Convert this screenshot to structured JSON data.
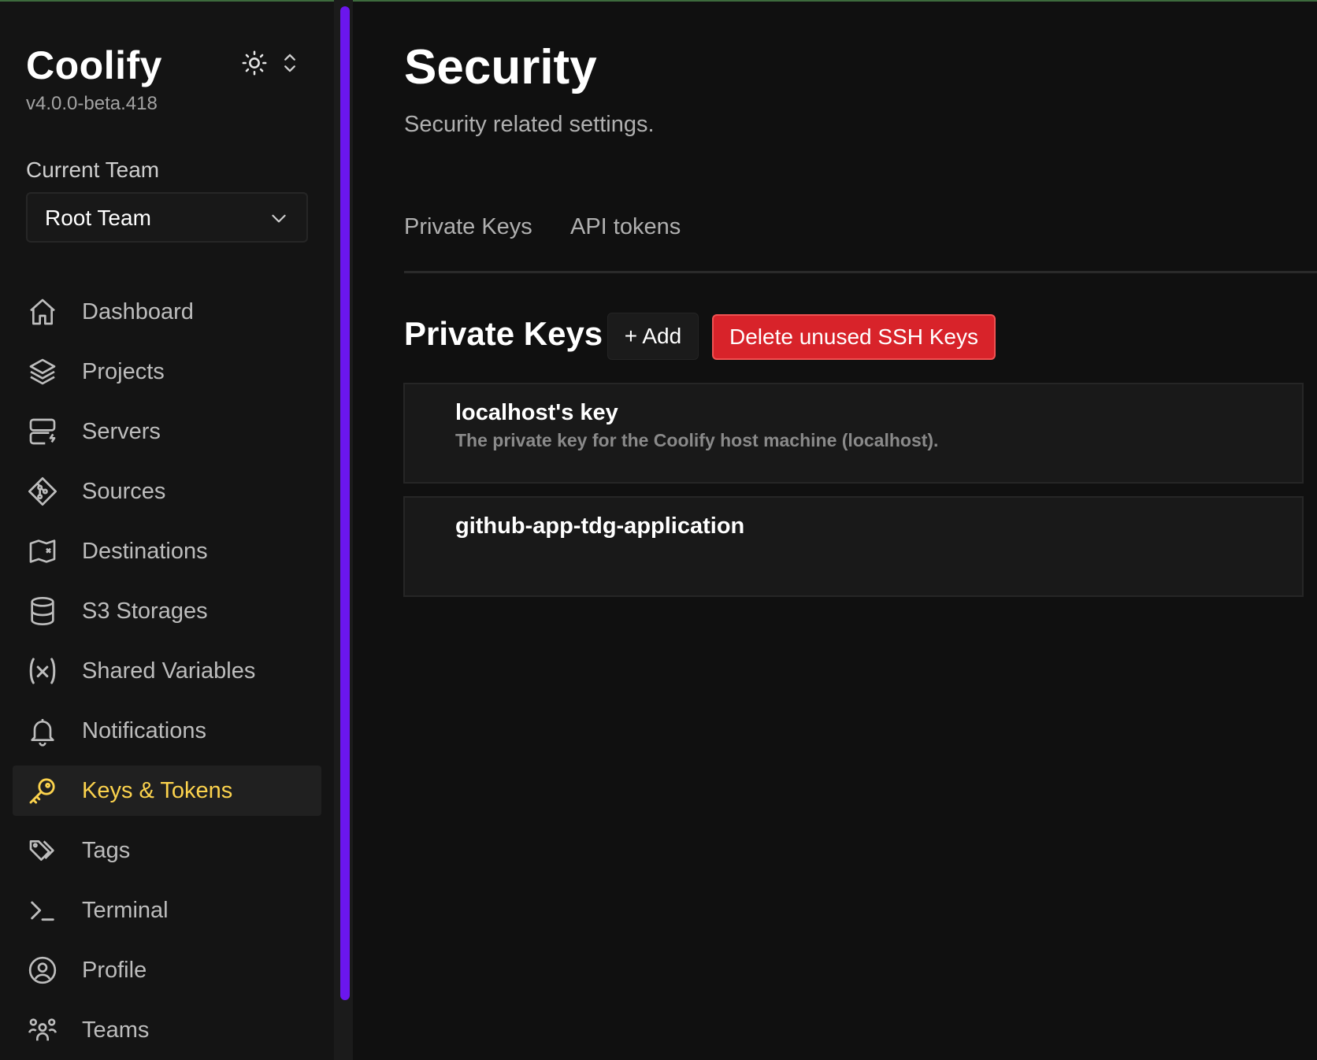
{
  "app": {
    "name": "Coolify",
    "version": "v4.0.0-beta.418"
  },
  "colors": {
    "accent_active": "#fcd34d",
    "scroll_thumb": "#6b16ed",
    "danger": "#d8232a",
    "background": "#101010"
  },
  "sidebar": {
    "theme_icon": "sun-icon",
    "team_label": "Current Team",
    "team_selected": "Root Team",
    "items": [
      {
        "label": "Dashboard",
        "icon": "home-icon"
      },
      {
        "label": "Projects",
        "icon": "layers-icon"
      },
      {
        "label": "Servers",
        "icon": "server-icon"
      },
      {
        "label": "Sources",
        "icon": "git-icon"
      },
      {
        "label": "Destinations",
        "icon": "map-icon"
      },
      {
        "label": "S3 Storages",
        "icon": "database-icon"
      },
      {
        "label": "Shared Variables",
        "icon": "variable-icon"
      },
      {
        "label": "Notifications",
        "icon": "bell-icon"
      },
      {
        "label": "Keys & Tokens",
        "icon": "key-icon",
        "active": true
      },
      {
        "label": "Tags",
        "icon": "tags-icon"
      },
      {
        "label": "Terminal",
        "icon": "terminal-icon"
      },
      {
        "label": "Profile",
        "icon": "user-circle-icon"
      },
      {
        "label": "Teams",
        "icon": "users-icon"
      }
    ]
  },
  "main": {
    "title": "Security",
    "subtitle": "Security related settings.",
    "tabs": [
      {
        "label": "Private Keys"
      },
      {
        "label": "API tokens"
      }
    ],
    "section_title": "Private Keys",
    "add_button": "+ Add",
    "delete_button": "Delete unused SSH Keys",
    "keys": [
      {
        "name": "localhost's key",
        "description": "The private key for the Coolify host machine (localhost)."
      },
      {
        "name": "github-app-tdg-application",
        "description": ""
      }
    ]
  }
}
